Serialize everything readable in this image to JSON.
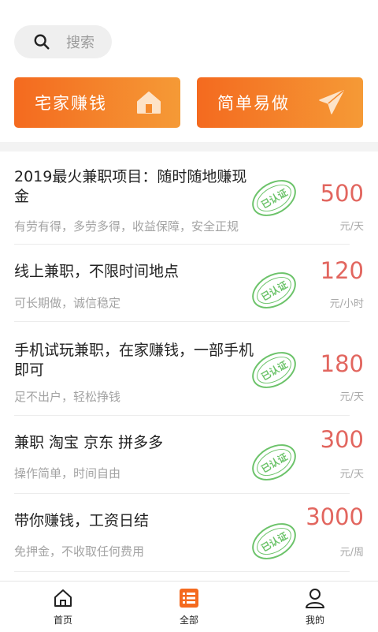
{
  "search": {
    "placeholder": "搜索"
  },
  "categories": [
    {
      "label": "宅家赚钱",
      "icon": "house-icon"
    },
    {
      "label": "简单易做",
      "icon": "paper-plane-icon"
    }
  ],
  "jobs": [
    {
      "title": "2019最火兼职项目：随时随地赚现金",
      "desc": "有劳有得，多劳多得，收益保障，安全正规",
      "price": "500",
      "unit": "元/天",
      "stamp": "已认证"
    },
    {
      "title": "线上兼职，不限时间地点",
      "desc": "可长期做，诚信稳定",
      "price": "120",
      "unit": "元/小时",
      "stamp": "已认证"
    },
    {
      "title": "手机试玩兼职，在家赚钱，一部手机即可",
      "desc": "足不出户，轻松挣钱",
      "price": "180",
      "unit": "元/天",
      "stamp": "已认证"
    },
    {
      "title": "兼职 淘宝 京东 拼多多",
      "desc": "操作简单，时间自由",
      "price": "300",
      "unit": "元/天",
      "stamp": "已认证"
    },
    {
      "title": "带你赚钱，工资日结",
      "desc": "免押金，不收取任何费用",
      "price": "3000",
      "unit": "元/周",
      "stamp": "已认证"
    }
  ],
  "tabbar": [
    {
      "label": "首页",
      "icon": "home-icon"
    },
    {
      "label": "全部",
      "icon": "list-icon",
      "active": true
    },
    {
      "label": "我的",
      "icon": "user-icon"
    }
  ],
  "colors": {
    "accent": "#f46a1f",
    "price": "#e2665f",
    "stamp": "#6cc36a"
  }
}
